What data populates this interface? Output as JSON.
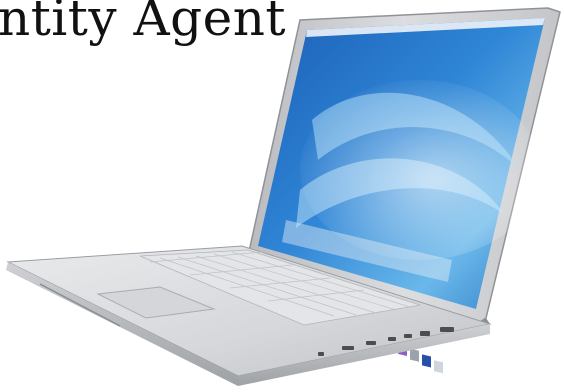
{
  "caption": {
    "text": "ntity Agent"
  },
  "image": {
    "subject": "laptop",
    "colors": {
      "screen_blue": "#2f78c8",
      "screen_light": "#9fd0f2",
      "aluminum": "#d9dadc",
      "aluminum_dark": "#a6a8ab",
      "keyboard": "#e7e8ea",
      "bezel": "#c9cacc"
    },
    "dock_icons": [
      "finder-icon",
      "mail-icon",
      "safari-icon",
      "ichat-icon",
      "address-book-icon",
      "ical-icon",
      "iphoto-icon",
      "itunes-icon",
      "imovie-icon",
      "idvd-icon",
      "preferences-icon",
      "quicktime-icon",
      "trash-icon"
    ]
  }
}
